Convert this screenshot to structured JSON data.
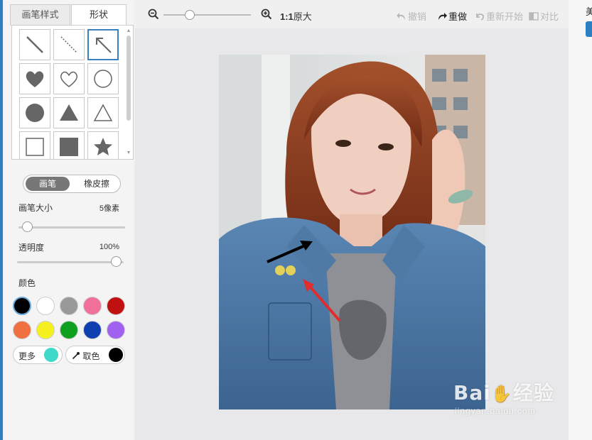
{
  "tabs": {
    "brush_style": "画笔样式",
    "shapes": "形状"
  },
  "shapes": [
    "line",
    "dashed-line",
    "arrow",
    "filled-heart",
    "outline-heart",
    "outline-circle",
    "filled-circle",
    "filled-triangle",
    "outline-triangle",
    "outline-square",
    "filled-square",
    "star"
  ],
  "mode": {
    "brush": "画笔",
    "eraser": "橡皮擦"
  },
  "brush_size": {
    "label": "画笔大小",
    "value": "5像素",
    "level": 0.05
  },
  "opacity": {
    "label": "透明度",
    "value": "100%",
    "level": 1.0
  },
  "colors": {
    "label": "颜色",
    "swatches": [
      "#000000",
      "#ffffff",
      "#999999",
      "#f0709a",
      "#c01010",
      "#f07040",
      "#f5f020",
      "#10a020",
      "#1040b0",
      "#a060f0"
    ],
    "more_label": "更多",
    "more_color": "#40d8c8",
    "picker_label": "取色",
    "picker_color": "#000000"
  },
  "toolbar": {
    "zoom_label": "1:1",
    "zoom_text": "原大",
    "undo": "撤销",
    "redo": "重做",
    "restart": "重新开始",
    "compare": "对比"
  },
  "watermark": {
    "main": "Bai",
    "brand": "经验",
    "sub": "jingyan.baidu.com"
  },
  "right_strip": {
    "char": "美"
  }
}
